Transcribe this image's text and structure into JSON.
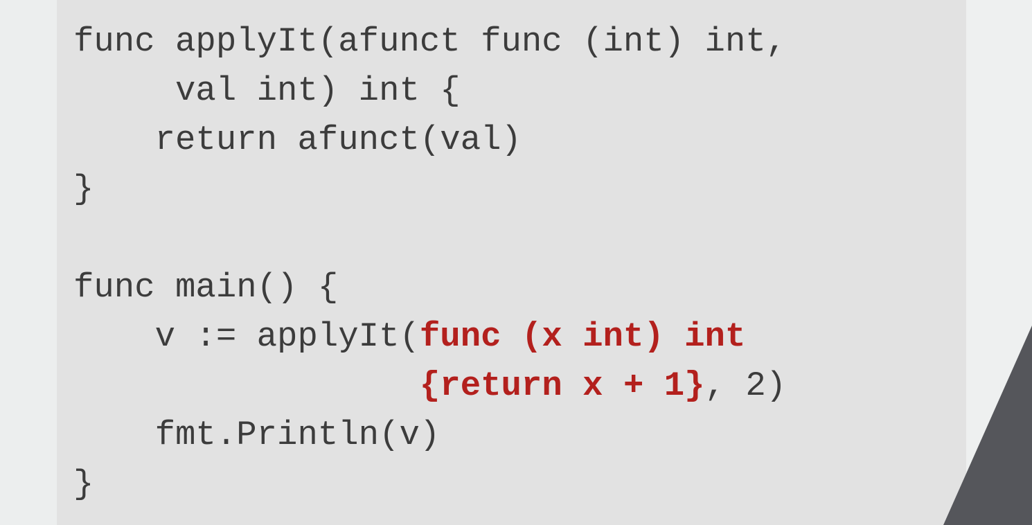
{
  "colors": {
    "panel_background": "#e2e2e2",
    "code_text": "#3c3c3c",
    "highlight_text": "#b3201d",
    "wedge": "#55565b"
  },
  "code": {
    "line1": "func applyIt(afunct func (int) int,",
    "line2": "     val int) int {",
    "line3": "    return afunct(val)",
    "line4": "}",
    "line5": "func main() {",
    "line6_plain": "    v := applyIt(",
    "line6_highlight": "func (x int) int",
    "line7_indent": "                 ",
    "line7_highlight": "{return x + 1}",
    "line7_plain": ", 2)",
    "line8": "    fmt.Println(v)",
    "line9": "}"
  }
}
